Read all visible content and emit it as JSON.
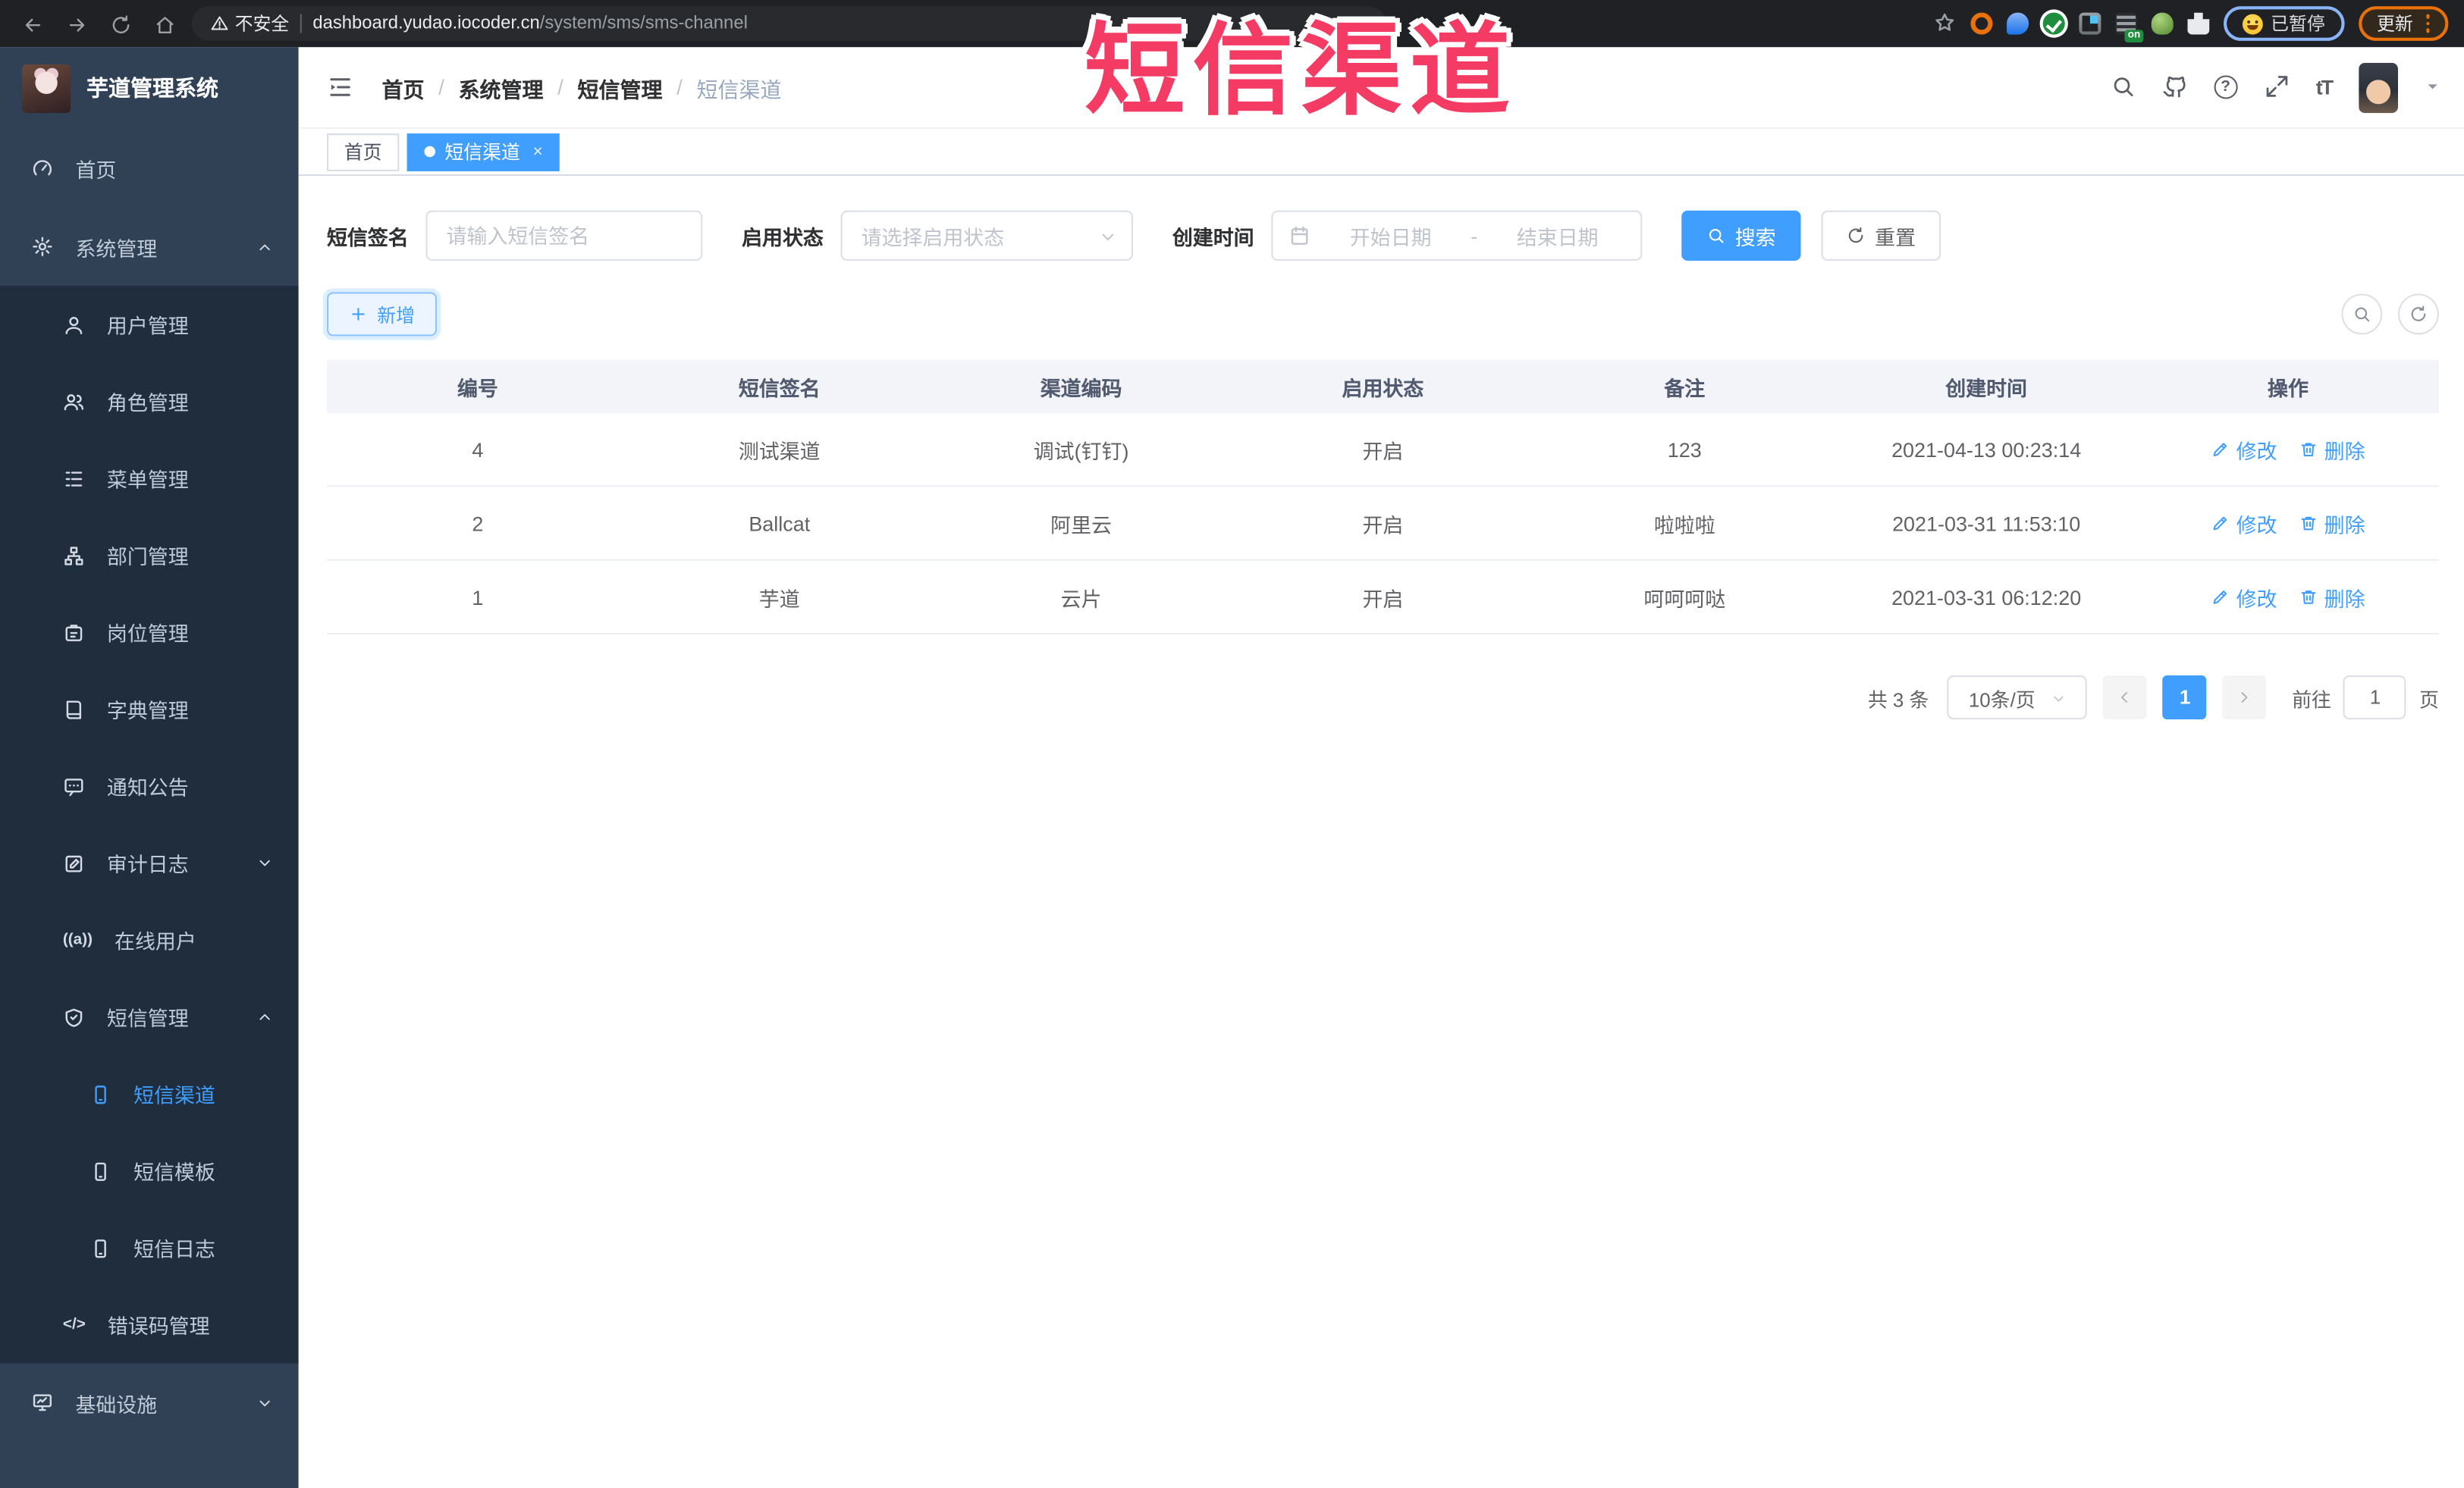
{
  "browser": {
    "security_label": "不安全",
    "url_host": "dashboard.yudao.iocoder.cn",
    "url_path": "/system/sms/sms-channel",
    "paused_label": "已暂停",
    "update_label": "更新",
    "on_badge": "on"
  },
  "watermark": "短信渠道",
  "sidebar": {
    "title": "芋道管理系统",
    "items": [
      {
        "label": "首页"
      },
      {
        "label": "系统管理"
      },
      {
        "label": "用户管理"
      },
      {
        "label": "角色管理"
      },
      {
        "label": "菜单管理"
      },
      {
        "label": "部门管理"
      },
      {
        "label": "岗位管理"
      },
      {
        "label": "字典管理"
      },
      {
        "label": "通知公告"
      },
      {
        "label": "审计日志"
      },
      {
        "label": "在线用户"
      },
      {
        "label": "短信管理"
      },
      {
        "label": "短信渠道"
      },
      {
        "label": "短信模板"
      },
      {
        "label": "短信日志"
      },
      {
        "label": "错误码管理"
      },
      {
        "label": "基础设施"
      }
    ]
  },
  "header": {
    "breadcrumb": [
      {
        "label": "首页"
      },
      {
        "label": "系统管理"
      },
      {
        "label": "短信管理"
      },
      {
        "label": "短信渠道"
      }
    ]
  },
  "tabs": [
    {
      "label": "首页"
    },
    {
      "label": "短信渠道"
    }
  ],
  "filters": {
    "sign_label": "短信签名",
    "sign_placeholder": "请输入短信签名",
    "status_label": "启用状态",
    "status_placeholder": "请选择启用状态",
    "time_label": "创建时间",
    "start_placeholder": "开始日期",
    "range_separator": "-",
    "end_placeholder": "结束日期",
    "search_label": "搜索",
    "reset_label": "重置"
  },
  "toolbar": {
    "add_label": "新增"
  },
  "table": {
    "columns": [
      "编号",
      "短信签名",
      "渠道编码",
      "启用状态",
      "备注",
      "创建时间",
      "操作"
    ],
    "edit_label": "修改",
    "delete_label": "删除",
    "rows": [
      {
        "id": "4",
        "sign": "测试渠道",
        "code": "调试(钉钉)",
        "status": "开启",
        "remark": "123",
        "time": "2021-04-13 00:23:14"
      },
      {
        "id": "2",
        "sign": "Ballcat",
        "code": "阿里云",
        "status": "开启",
        "remark": "啦啦啦",
        "time": "2021-03-31 11:53:10"
      },
      {
        "id": "1",
        "sign": "芋道",
        "code": "云片",
        "status": "开启",
        "remark": "呵呵呵哒",
        "time": "2021-03-31 06:12:20"
      }
    ]
  },
  "pagination": {
    "total": "共 3 条",
    "page_size": "10条/页",
    "current_page": "1",
    "goto_label": "前往",
    "goto_value": "1",
    "unit_label": "页"
  },
  "colors": {
    "accent": "#409eff",
    "watermark": "#f43b63",
    "sidebar_bg": "#304156",
    "submenu_bg": "#1f2d3d"
  }
}
